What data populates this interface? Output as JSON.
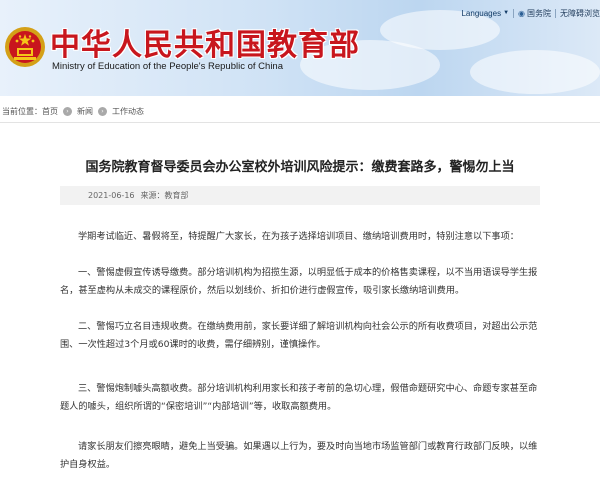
{
  "header": {
    "title": "中华人民共和国教育部",
    "subtitle": "Ministry of Education of the People's Republic of China",
    "languages_label": "Languages",
    "gov_link": "国务院",
    "accessibility_link": "无障碍浏览",
    "emblem_icon": "national-emblem-icon"
  },
  "breadcrumb": {
    "prefix": "当前位置：",
    "items": [
      "首页",
      "新闻",
      "工作动态"
    ]
  },
  "article": {
    "title": "国务院教育督导委员会办公室校外培训风险提示：缴费套路多，警惕勿上当",
    "date": "2021-06-16",
    "source": "来源：教育部",
    "paragraphs": [
      "学期考试临近、暑假将至，特提醒广大家长，在为孩子选择培训项目、缴纳培训费用时，特别注意以下事项：",
      "一、警惕虚假宣传诱导缴费。部分培训机构为招揽生源，以明显低于成本的价格售卖课程，以不当用语误导学生报名，甚至虚构从未成交的课程原价，然后以划线价、折扣价进行虚假宣传，吸引家长缴纳培训费用。",
      "二、警惕巧立名目违规收费。在缴纳费用前，家长要详细了解培训机构向社会公示的所有收费项目，对超出公示范围、一次性超过3个月或60课时的收费，需仔细辨别，谨慎操作。",
      "三、警惕炮制噱头高额收费。部分培训机构利用家长和孩子考前的急切心理，假借命题研究中心、命题专家甚至命题人的噱头，组织所谓的“保密培训”“内部培训”等，收取高额费用。",
      "请家长朋友们擦亮眼睛，避免上当受骗。如果遇以上行为，要及时向当地市场监管部门或教育行政部门反映，以维护自身权益。"
    ]
  },
  "colors": {
    "title_red": "#c8161d",
    "header_blue": "#bcd6f0"
  }
}
